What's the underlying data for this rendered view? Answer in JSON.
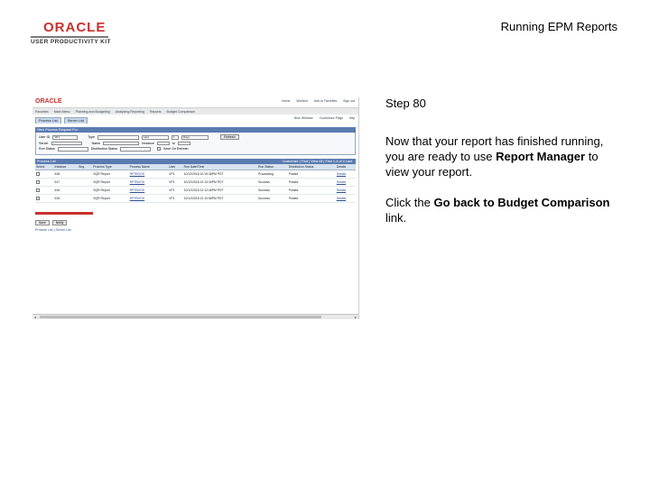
{
  "header": {
    "logo_brand": "ORACLE",
    "logo_product": "USER PRODUCTIVITY KIT",
    "page_title": "Running EPM Reports"
  },
  "screenshot": {
    "brand": "ORACLE",
    "top_links": [
      "Home",
      "Worklist",
      "Add to Favorites",
      "Add to Favorites",
      "Sign out"
    ],
    "menu": [
      "Favorites",
      "Main Menu",
      "Planning and Budgeting",
      "Analyzing Reporting",
      "Reports",
      "Budget Comparison"
    ],
    "tabs": [
      "Process List",
      "Server List"
    ],
    "page_links": [
      "New Window",
      "Customize Page",
      "http"
    ],
    "filter": {
      "title": "View Process Request For",
      "user_label": "User ID",
      "user_value": "VP1",
      "type_label": "Type",
      "last_label": "Last",
      "last_value": "1",
      "days_value": "Days",
      "refresh_label": "Refresh",
      "server_label": "Server",
      "name_label": "Name",
      "instance_label": "Instance",
      "to_label": "to",
      "run_status_label": "Run Status",
      "dist_status_label": "Distribution Status",
      "save_on_refresh_label": "Save On Refresh"
    },
    "process_list": {
      "title": "Process List",
      "nav": "Customize | Find | View All | First 1-4 of 4 Last",
      "columns": [
        "Select",
        "Instance",
        "Seq.",
        "Process Type",
        "Process Name",
        "User",
        "Run Date/Time",
        "Run Status",
        "Distribution Status",
        "Details"
      ],
      "rows": [
        [
          "",
          "618",
          "",
          "SQR Report",
          "RPTBOOK",
          "VP1",
          "10/12/2018 12:15:36PM PDT",
          "Processing",
          "Posted",
          "Details"
        ],
        [
          "",
          "617",
          "",
          "SQR Report",
          "RPTBOOK",
          "VP1",
          "10/12/2018 12:13:30PM PDT",
          "Success",
          "Posted",
          "Details"
        ],
        [
          "",
          "616",
          "",
          "SQR Report",
          "RPTBOOK",
          "VP1",
          "10/12/2018 12:12:46PM PDT",
          "Success",
          "Posted",
          "Details"
        ],
        [
          "",
          "615",
          "",
          "SQR Report",
          "RPTBOOK",
          "VP1",
          "10/12/2018 12:10:56PM PDT",
          "Success",
          "Posted",
          "Details"
        ]
      ]
    },
    "go_back_link": "Go back to Budget Comparison",
    "save_button": "Save",
    "notify_button": "Notify",
    "bottom_links": "Process List | Server List"
  },
  "instructions": {
    "step": "Step 80",
    "para1_prefix": "Now that your report has finished running, you are ready to use ",
    "para1_bold": "Report Manager",
    "para1_suffix": " to view your report.",
    "para2_prefix": "Click the ",
    "para2_bold": "Go back to Budget Comparison",
    "para2_suffix": " link."
  },
  "colors": {
    "oracle_red": "#c9302c",
    "ps_header_blue": "#5a7bb0"
  }
}
